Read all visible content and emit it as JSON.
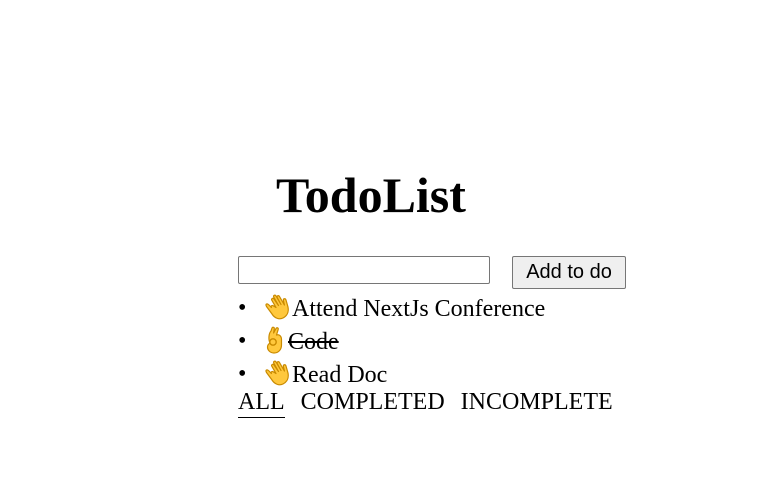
{
  "header": {
    "title": "TodoList"
  },
  "add_form": {
    "input_value": "",
    "input_placeholder": "",
    "button_label": "Add to do"
  },
  "todos": [
    {
      "text": "Attend NextJs Conference",
      "completed": false,
      "icon": "waving-hand-icon"
    },
    {
      "text": "Code",
      "completed": true,
      "icon": "ok-hand-icon"
    },
    {
      "text": "Read Doc",
      "completed": false,
      "icon": "waving-hand-icon"
    }
  ],
  "list": {
    "bullet": "•"
  },
  "filters": {
    "all": "ALL",
    "completed": "COMPLETED",
    "incomplete": "INCOMPLETE",
    "active": "all"
  },
  "colors": {
    "emoji_skin": "#FFC83D",
    "emoji_outline": "#C98A00",
    "text": "#000000",
    "button_bg": "#efefef",
    "button_border": "#767676"
  }
}
